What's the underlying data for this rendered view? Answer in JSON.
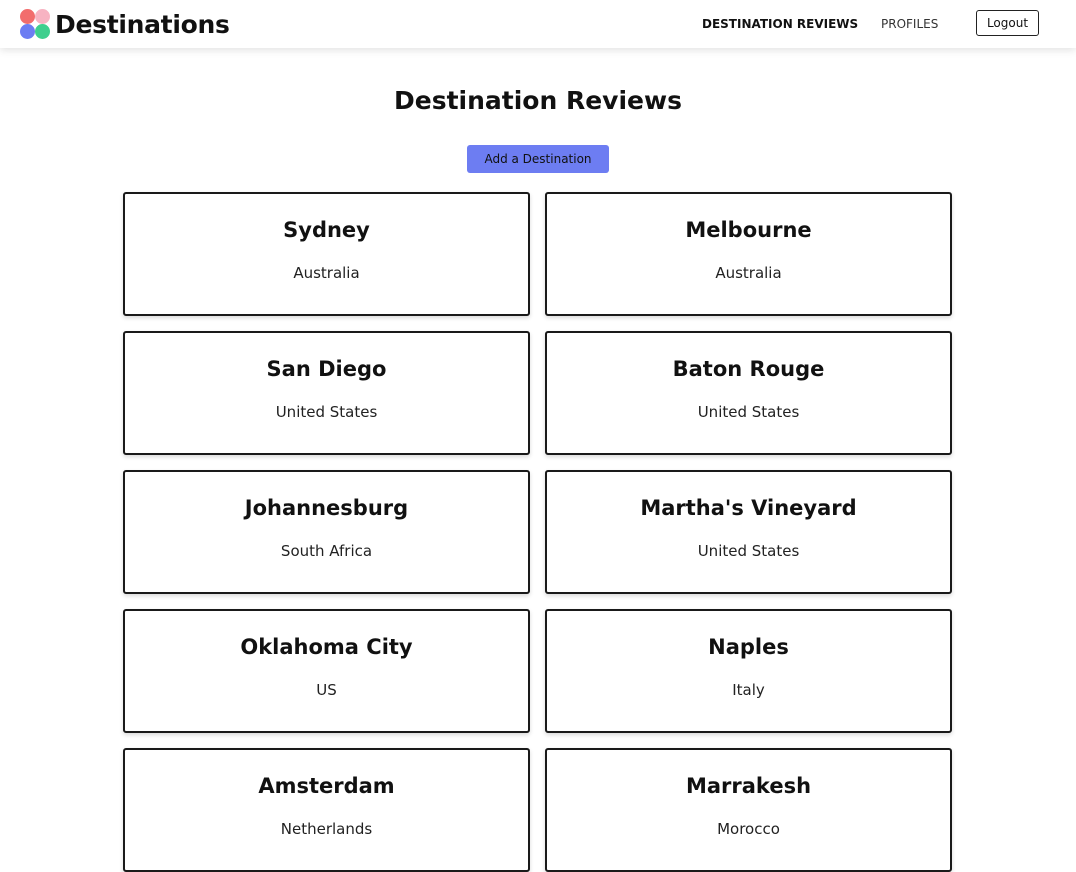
{
  "brand": {
    "name": "Destinations",
    "logo_colors": [
      "#f26d6d",
      "#f7b3c2",
      "#6d7df2",
      "#3fcf8e"
    ]
  },
  "nav": {
    "reviews_label": "DESTINATION REVIEWS",
    "profiles_label": "PROFILES",
    "logout_label": "Logout"
  },
  "main": {
    "title": "Destination Reviews",
    "add_button_label": "Add a Destination",
    "accent_color": "#6d7df2"
  },
  "destinations": [
    {
      "city": "Sydney",
      "country": "Australia"
    },
    {
      "city": "Melbourne",
      "country": "Australia"
    },
    {
      "city": "San Diego",
      "country": "United States"
    },
    {
      "city": "Baton Rouge",
      "country": "United States"
    },
    {
      "city": "Johannesburg",
      "country": "South Africa"
    },
    {
      "city": "Martha's Vineyard",
      "country": "United States"
    },
    {
      "city": "Oklahoma City",
      "country": "US"
    },
    {
      "city": "Naples",
      "country": "Italy"
    },
    {
      "city": "Amsterdam",
      "country": "Netherlands"
    },
    {
      "city": "Marrakesh",
      "country": "Morocco"
    }
  ]
}
